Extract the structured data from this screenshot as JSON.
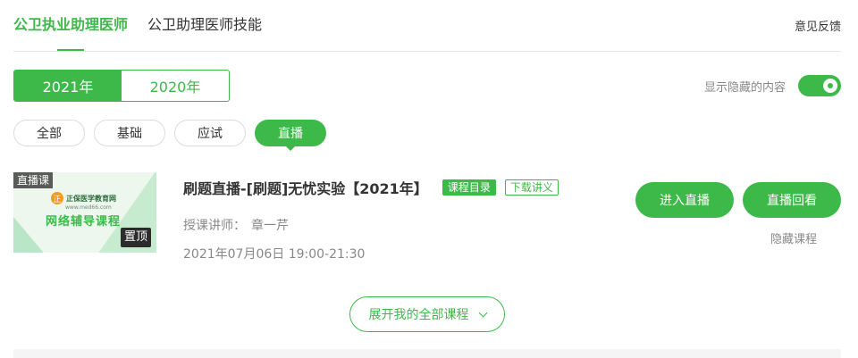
{
  "nav": {
    "tabs": [
      {
        "label": "公卫执业助理医师",
        "active": true
      },
      {
        "label": "公卫助理医师技能",
        "active": false
      }
    ],
    "feedback": "意见反馈"
  },
  "years": [
    {
      "label": "2021年",
      "active": true
    },
    {
      "label": "2020年",
      "active": false
    }
  ],
  "hidden_toggle": {
    "label": "显示隐藏的内容",
    "on": true
  },
  "filters": [
    {
      "label": "全部",
      "active": false
    },
    {
      "label": "基础",
      "active": false
    },
    {
      "label": "应试",
      "active": false
    },
    {
      "label": "直播",
      "active": true
    }
  ],
  "course": {
    "thumb": {
      "live_tag": "直播课",
      "logo_mark": "正",
      "logo_text": "正保医学教育网",
      "logo_url": "www.med66.com",
      "banner": "网络辅导课程",
      "pin_tag": "置顶"
    },
    "title": "刷题直播-[刷题]无忧实验【2021年】",
    "catalog_btn": "课程目录",
    "download_btn": "下载讲义",
    "teacher_label": "授课讲师：",
    "teacher_name": "章一芹",
    "time": "2021年07月06日 19:00-21:30",
    "enter_btn": "进入直播",
    "replay_btn": "直播回看",
    "hide_link": "隐藏课程"
  },
  "expand_btn": "展开我的全部课程",
  "colors": {
    "accent": "#3db94a"
  }
}
